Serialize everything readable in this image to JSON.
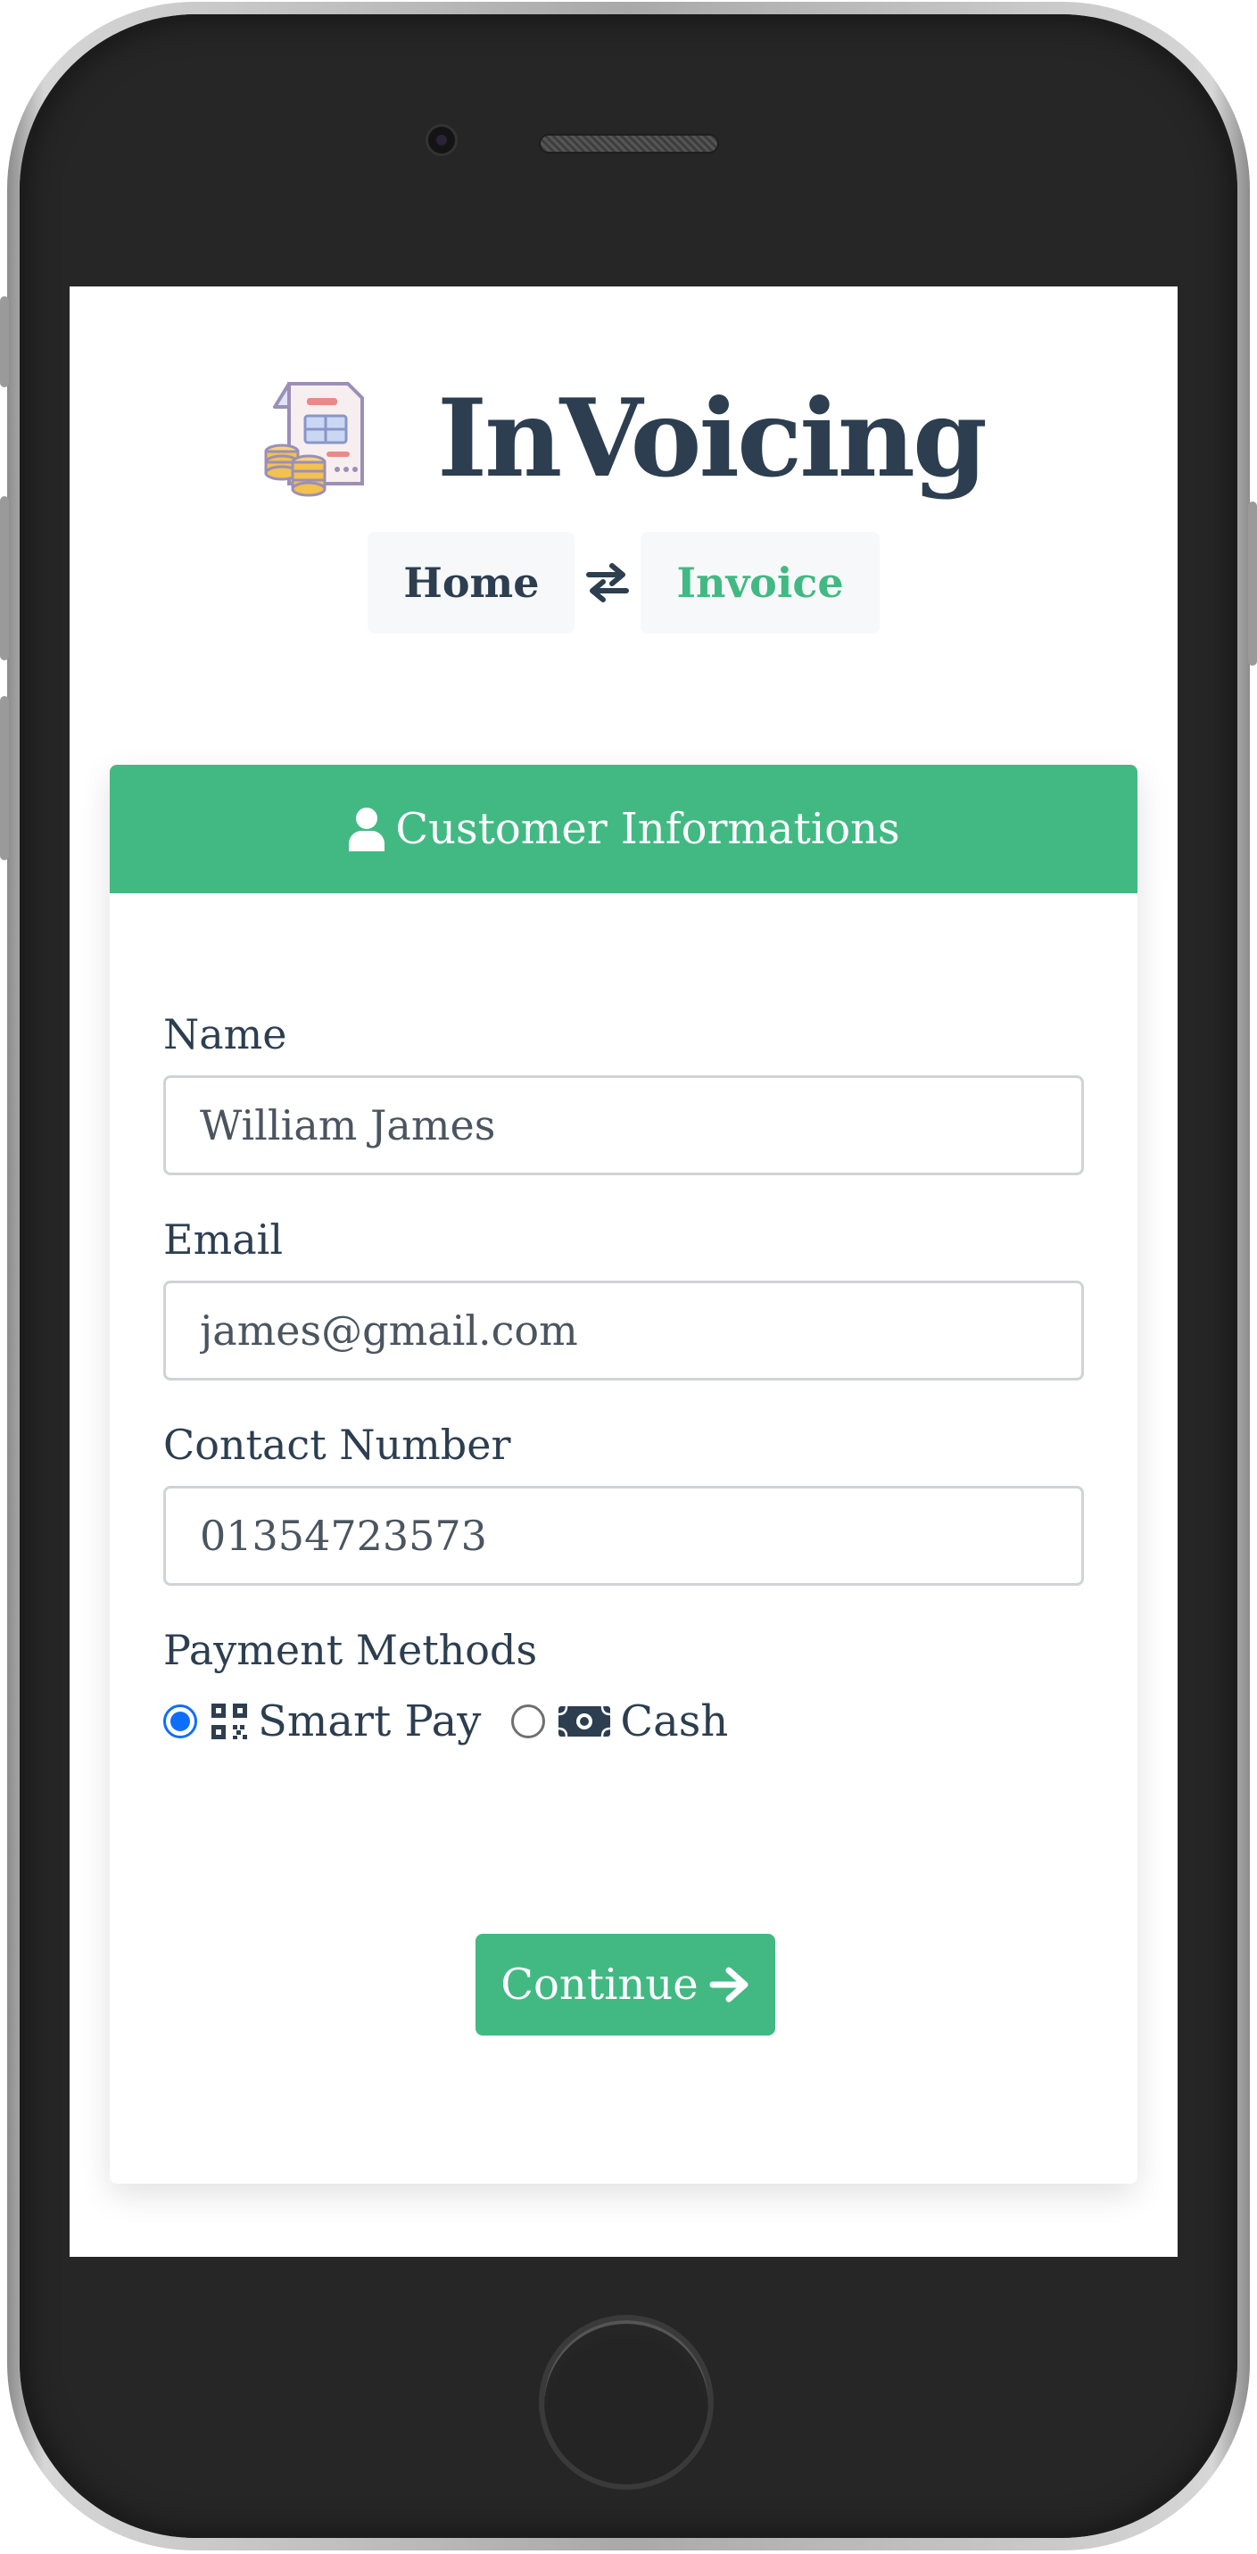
{
  "app": {
    "title": "InVoicing",
    "logo_icon": "invoice-coins-icon"
  },
  "nav": {
    "home_label": "Home",
    "swap_icon": "exchange-arrows-icon",
    "invoice_label": "Invoice",
    "active": "Invoice"
  },
  "card": {
    "header_icon": "user-icon",
    "header_title": "Customer Informations"
  },
  "form": {
    "name": {
      "label": "Name",
      "value": "William James"
    },
    "email": {
      "label": "Email",
      "value": "james@gmail.com"
    },
    "contact": {
      "label": "Contact Number",
      "value": "01354723573"
    },
    "payment": {
      "label": "Payment Methods",
      "options": [
        {
          "label": "Smart Pay",
          "icon": "qrcode-icon",
          "selected": true
        },
        {
          "label": "Cash",
          "icon": "money-bill-icon",
          "selected": false
        }
      ]
    }
  },
  "actions": {
    "continue_label": "Continue",
    "continue_icon": "arrow-right-icon"
  },
  "colors": {
    "accent": "#42b983",
    "text": "#2c3e50",
    "radio_selected": "#0d6efd"
  }
}
